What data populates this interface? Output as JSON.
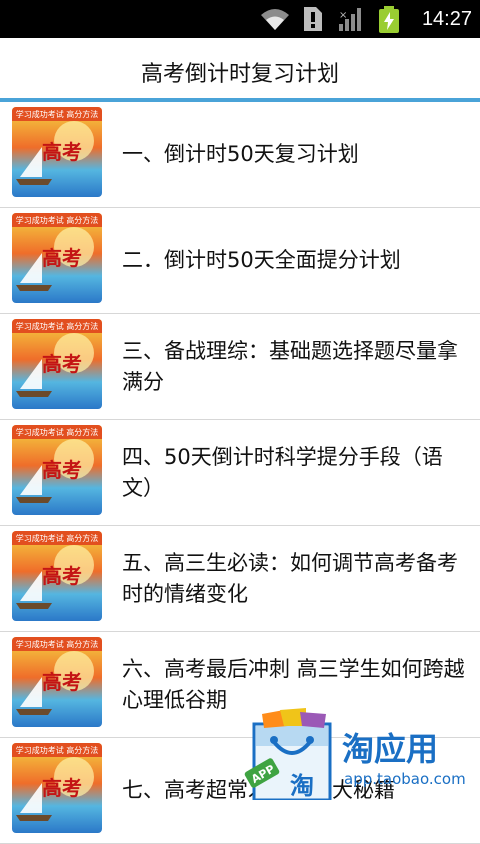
{
  "status_bar": {
    "time": "14:27",
    "icons": [
      "wifi-icon",
      "alert-icon",
      "signal-icon",
      "battery-charging-icon"
    ]
  },
  "header": {
    "title": "高考倒计时复习计划"
  },
  "thumbnail": {
    "banner_text": "高考",
    "top_text": "学习成功考试 高分方法"
  },
  "list": {
    "items": [
      {
        "label": "一、倒计时50天复习计划"
      },
      {
        "label": "二．倒计时50天全面提分计划"
      },
      {
        "label": "三、备战理综：基础题选择题尽量拿满分"
      },
      {
        "label": "四、50天倒计时科学提分手段（语文）"
      },
      {
        "label": "五、高三生必读：如何调节高考备考时的情绪变化"
      },
      {
        "label": "六、高考最后冲刺 高三学生如何跨越心理低谷期"
      },
      {
        "label": "七、高考超常发挥的十大秘籍"
      }
    ]
  },
  "overlay_badge": {
    "name": "淘应用",
    "url": "app.taobao.com",
    "app_tag": "APP",
    "bag_char": "淘"
  },
  "colors": {
    "accent": "#4aa3d8",
    "status_bar_bg": "#000000",
    "divider": "#d7d7d7",
    "badge_blue": "#1a6fc4"
  }
}
